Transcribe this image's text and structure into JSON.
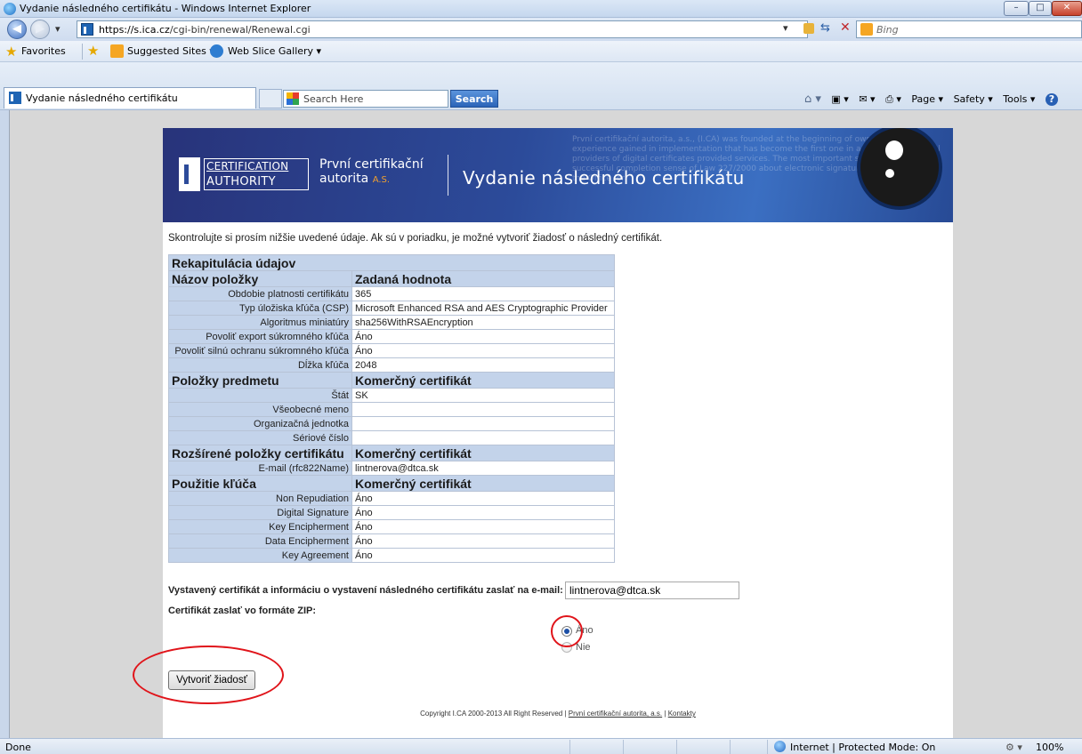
{
  "window": {
    "title": "Vydanie následného certifikátu - Windows Internet Explorer",
    "controls": {
      "minimize": "–",
      "maximize": "□",
      "close": "✕"
    }
  },
  "nav": {
    "back": "◀",
    "forward": "▶"
  },
  "address": {
    "url_domain": "https://s.ica.cz",
    "url_path": "/cgi-bin/renewal/Renewal.cgi",
    "search_placeholder": "Bing"
  },
  "favorites": {
    "label": "Favorites",
    "suggested": "Suggested Sites ▾",
    "webslice": "Web Slice Gallery ▾"
  },
  "tabs": {
    "active_title": "Vydanie následného certifikátu"
  },
  "toolbar": {
    "search_placeholder": "Search Here",
    "search_button": "Search",
    "page": "Page ▾",
    "safety": "Safety ▾",
    "tools": "Tools ▾",
    "help": "?"
  },
  "banner": {
    "logo_line1": "CERTIFICATION",
    "logo_line2": "AUTHORITY",
    "brand_line1": "První certifikační",
    "brand_line2": "autorita",
    "brand_suffix": "A.S.",
    "title": "Vydanie následného certifikátu",
    "background_text": "První certifikační autorita, a.s., (I.CA) was founded at the beginning of own expertise and experience gained in implementation that has become the first one in a field of commercial providers of digital certificates provided services. The most important step forwards was a successful completion sense of Law 227/2000 about electronic signature and collaboration the Office for"
  },
  "intro": "Skontrolujte si prosím nižšie uvedené údaje. Ak sú v poriadku, je možné vytvoriť žiadosť o následný certifikát.",
  "recap": {
    "title": "Rekapitulácia údajov",
    "col_name": "Názov položky",
    "col_value": "Zadaná hodnota",
    "general": [
      {
        "label": "Obdobie platnosti certifikátu",
        "value": "365"
      },
      {
        "label": "Typ úložiska kľúča (CSP)",
        "value": "Microsoft Enhanced RSA and AES Cryptographic Provider"
      },
      {
        "label": "Algoritmus miniatúry",
        "value": "sha256WithRSAEncryption"
      },
      {
        "label": "Povoliť export súkromného kľúča",
        "value": "Áno"
      },
      {
        "label": "Povoliť silnú ochranu súkromného kľúča",
        "value": "Áno"
      },
      {
        "label": "Dĺžka kľúča",
        "value": "2048"
      }
    ],
    "subject_title": "Položky predmetu",
    "subject_value_header": "Komerčný certifikát",
    "subject": [
      {
        "label": "Štát",
        "value": "SK"
      },
      {
        "label": "Všeobecné meno",
        "value": ""
      },
      {
        "label": "Organizačná jednotka",
        "value": ""
      },
      {
        "label": "Sériové číslo",
        "value": ""
      }
    ],
    "ext_title": "Rozšírené položky certifikátu",
    "ext_value_header": "Komerčný certifikát",
    "ext": [
      {
        "label": "E-mail (rfc822Name)",
        "value": "lintnerova@dtca.sk"
      }
    ],
    "usage_title": "Použitie kľúča",
    "usage_value_header": "Komerčný certifikát",
    "usage": [
      {
        "label": "Non Repudiation",
        "value": "Áno"
      },
      {
        "label": "Digital Signature",
        "value": "Áno"
      },
      {
        "label": "Key Encipherment",
        "value": "Áno"
      },
      {
        "label": "Data Encipherment",
        "value": "Áno"
      },
      {
        "label": "Key Agreement",
        "value": "Áno"
      }
    ]
  },
  "form": {
    "email_label": "Vystavený certifikát a informáciu o vystavení následného certifikátu zaslať na e-mail:",
    "email_value": "lintnerova@dtca.sk",
    "zip_label": "Certifikát zaslať vo formáte ZIP:",
    "zip_yes": "Áno",
    "zip_no": "Nie",
    "submit": "Vytvoriť žiadosť"
  },
  "footer": {
    "copyright": "Copyright I.CA 2000-2013 All Right Reserved |",
    "link1": "První certifikační autorita, a.s.",
    "sep": "|",
    "link2": "Kontakty"
  },
  "statusbar": {
    "left": "Done",
    "zone": "Internet | Protected Mode: On",
    "zoom": "100%"
  }
}
